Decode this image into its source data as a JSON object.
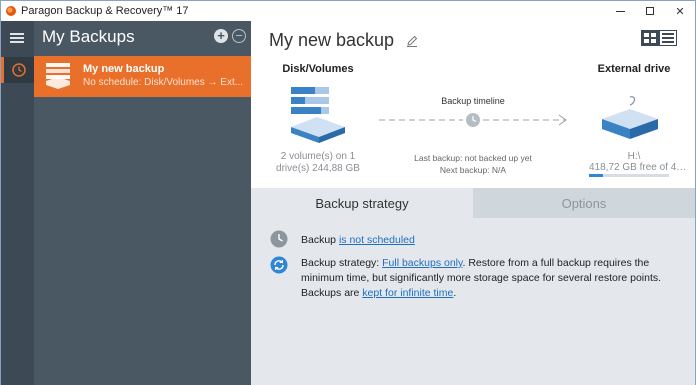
{
  "window": {
    "title": "Paragon Backup & Recovery™ 17",
    "controls": {
      "minimize": "",
      "maximize": "",
      "close": "✕"
    }
  },
  "rail": {
    "menu_icon": "hamburger-icon",
    "active_item_icon": "clock-icon"
  },
  "backups": {
    "title": "My Backups",
    "add_icon": "plus-circle-icon",
    "add_label": "+",
    "remove_icon": "minus-circle-icon",
    "remove_label": "−",
    "items": [
      {
        "name": "My new backup",
        "subtitle": "No schedule: Disk/Volumes → Ext...",
        "icon": "disk-stack-icon"
      }
    ]
  },
  "main": {
    "title": "My new backup",
    "edit_icon": "pencil-icon",
    "view_toggle_icons": [
      "grid-view-icon",
      "list-view-icon"
    ],
    "source": {
      "label": "Disk/Volumes",
      "caption": "2 volume(s) on 1 drive(s) 244,88 GB"
    },
    "timeline": {
      "label": "Backup timeline",
      "last_backup": "Last backup: not backed up yet",
      "next_backup": "Next backup: N/A"
    },
    "destination": {
      "label": "External drive",
      "drive_letter": "H:\\",
      "free_space": "418,72 GB free of 49...",
      "usage_fraction": 0.18
    },
    "tabs": [
      {
        "label": "Backup strategy",
        "active": true
      },
      {
        "label": "Options",
        "active": false
      }
    ],
    "strategy": {
      "schedule_prefix": "Backup ",
      "schedule_link": "is not scheduled",
      "strategy_prefix": "Backup strategy: ",
      "strategy_link": "Full backups only",
      "strategy_text": ". Restore from a full backup requires the minimum time, but significantly more storage space for several restore points. Backups are ",
      "retention_link": "kept for infinite time",
      "retention_suffix": "."
    }
  },
  "colors": {
    "accent": "#e8702a",
    "sidebar": "#4a5864",
    "rail": "#3d4a55",
    "link": "#1f6fc0",
    "panel": "#e4e8ec"
  }
}
